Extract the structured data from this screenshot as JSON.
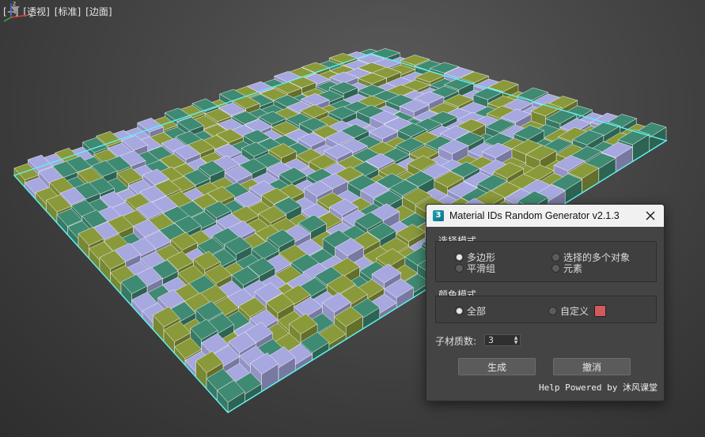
{
  "viewport": {
    "labels": [
      "[+]",
      "[透视]",
      "[标准]",
      "[边面]"
    ],
    "axis": {
      "z": "z",
      "x": "x"
    }
  },
  "dialog": {
    "title": "Material IDs Random Generator v2.1.3",
    "app_icon_text": "3",
    "selection_mode": {
      "title": "选择模式",
      "options": [
        "多边形",
        "选择的多个对象",
        "平滑组",
        "元素"
      ],
      "selected": "多边形"
    },
    "color_mode": {
      "title": "颜色模式",
      "options": [
        "全部",
        "自定义"
      ],
      "selected": "全部",
      "custom_color": "#d35a5a"
    },
    "submaterial_count": {
      "label": "子材质数:",
      "value": "3"
    },
    "buttons": {
      "generate": "生成",
      "cancel": "撤消"
    },
    "footer": "Help Powered by 沐风课堂"
  },
  "colors": {
    "cube_purple": "#a7a8e0",
    "cube_olive": "#8a9a3a",
    "cube_teal": "#3f8a72",
    "selection_outline": "#5ff2f2",
    "viewport_bg": "#4a4a4a"
  }
}
